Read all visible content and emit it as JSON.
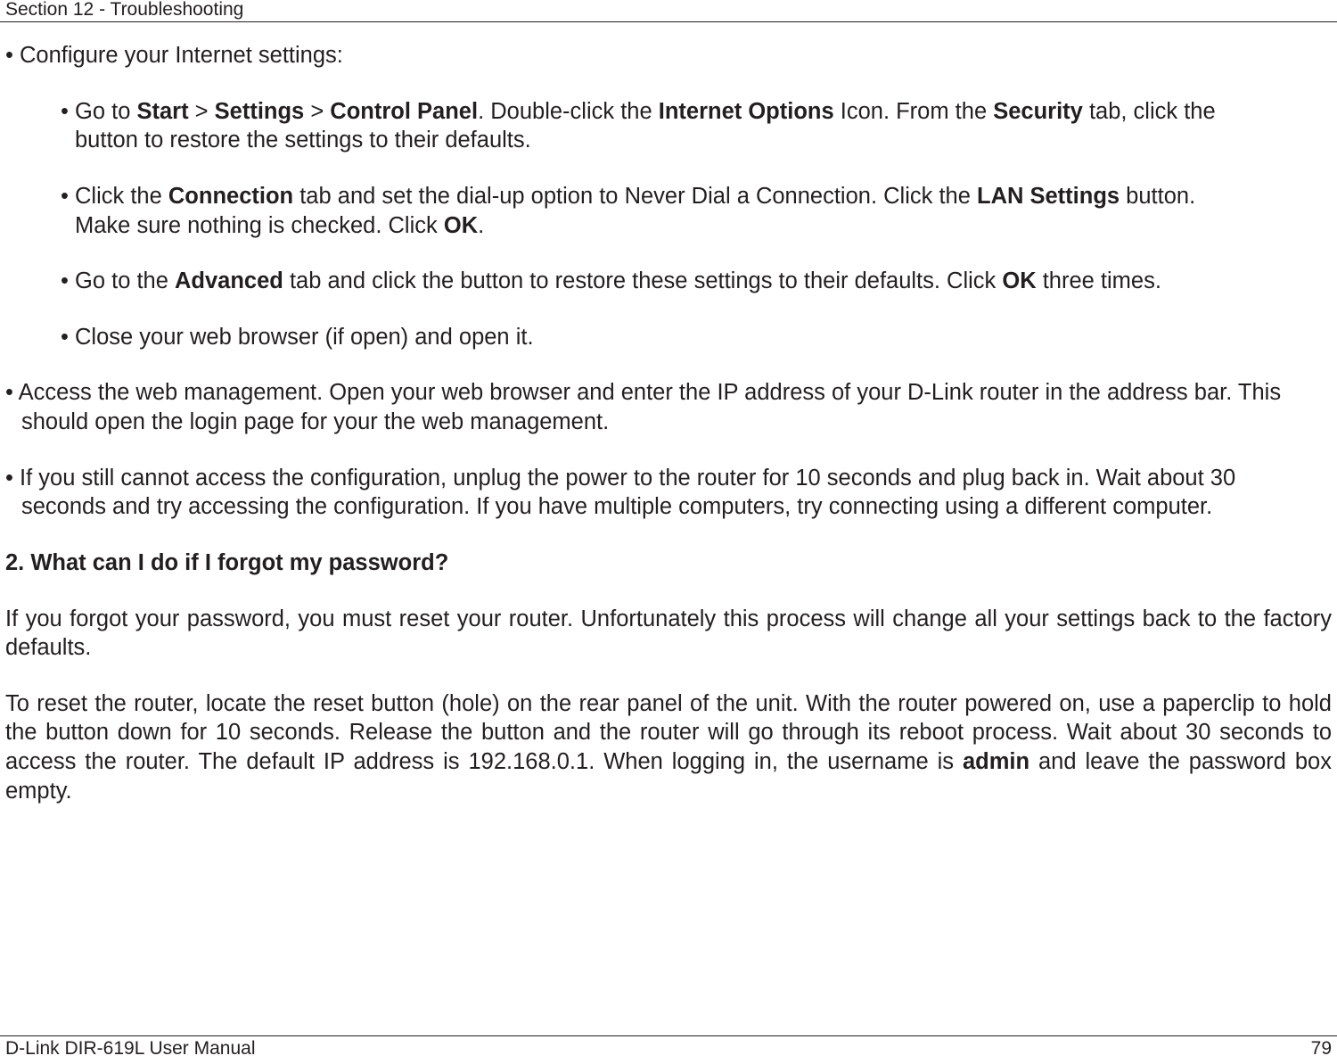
{
  "header": {
    "section": "Section 12 - Troubleshooting"
  },
  "content": {
    "line1": "• Configure your Internet settings:",
    "bullet2a_l1_part1": "• Go to ",
    "bullet2a_l1_bold1": "Start",
    "bullet2a_l1_part2": " > ",
    "bullet2a_l1_bold2": "Settings",
    "bullet2a_l1_part3": " > ",
    "bullet2a_l1_bold3": "Control Panel",
    "bullet2a_l1_part4": ". Double-click the ",
    "bullet2a_l1_bold4": "Internet Options",
    "bullet2a_l1_part5": " Icon. From the ",
    "bullet2a_l1_bold5": "Security",
    "bullet2a_l1_part6": " tab, click the ",
    "bullet2a_l2": "button to restore the settings to their defaults.",
    "bullet2b_l1_part1": "• Click the ",
    "bullet2b_l1_bold1": "Connection",
    "bullet2b_l1_part2": " tab and set the dial-up option to Never Dial a Connection. Click the ",
    "bullet2b_l1_bold2": "LAN Settings",
    "bullet2b_l1_part3": " button. ",
    "bullet2b_l2_part1": "Make sure nothing is checked. Click ",
    "bullet2b_l2_bold1": "OK",
    "bullet2b_l2_part2": ".",
    "bullet2c_part1": "• Go to the ",
    "bullet2c_bold1": "Advanced",
    "bullet2c_part2": " tab and click the button to restore these settings to their defaults. Click ",
    "bullet2c_bold2": "OK",
    "bullet2c_part3": " three times.",
    "bullet2d": "• Close your web browser (if open) and open it.",
    "bullet3_l1": "• Access the web management. Open your web browser and enter the IP address of your D-Link router in the address bar. This",
    "bullet3_l2": "should open the login page for your the web management.",
    "bullet4_l1": "• If you still cannot access the configuration, unplug the power to the router for 10 seconds and plug back in. Wait about 30",
    "bullet4_l2": "seconds and try accessing the configuration. If you have multiple computers, try connecting using a different computer.",
    "q2_heading": "2. What can I do if I forgot my password?",
    "p_forgot": "If you forgot your password, you must reset your router. Unfortunately this process will change all your settings back to the factory defaults.",
    "p_reset_part1": "To reset the router, locate the reset button (hole) on the rear panel of the unit. With the router powered on, use a paperclip to hold the button down for 10 seconds. Release the button and the router will go through its reboot process. Wait about 30 seconds to access the router. The default IP address is 192.168.0.1. When logging in, the username is ",
    "p_reset_bold": "admin",
    "p_reset_part2": " and leave the password box empty."
  },
  "footer": {
    "left": "D-Link DIR-619L User Manual",
    "right": "79"
  }
}
